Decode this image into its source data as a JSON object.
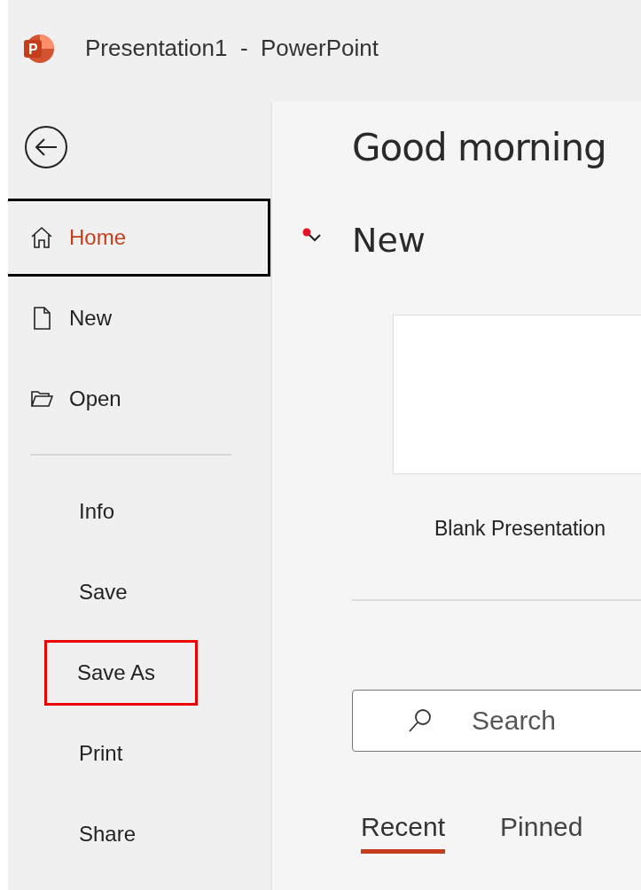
{
  "window": {
    "title": "Presentation1  -  PowerPoint"
  },
  "sidebar": {
    "items": [
      {
        "label": "Home",
        "kind": "home",
        "selected": true,
        "highlighted": false
      },
      {
        "label": "New",
        "kind": "document",
        "selected": false,
        "highlighted": false
      },
      {
        "label": "Open",
        "kind": "folder",
        "selected": false,
        "highlighted": false
      },
      {
        "kind": "divider"
      },
      {
        "label": "Info",
        "selected": false,
        "highlighted": false
      },
      {
        "label": "Save",
        "selected": false,
        "highlighted": false
      },
      {
        "label": "Save As",
        "selected": false,
        "highlighted": true
      },
      {
        "label": "Print",
        "selected": false,
        "highlighted": false
      },
      {
        "label": "Share",
        "selected": false,
        "highlighted": false
      }
    ]
  },
  "main": {
    "greeting": "Good morning",
    "new_section": {
      "title": "New",
      "expanded": true,
      "templates": [
        {
          "label": "Blank Presentation"
        }
      ]
    },
    "search": {
      "placeholder": "Search"
    },
    "tabs": [
      {
        "label": "Recent",
        "selected": true
      },
      {
        "label": "Pinned",
        "selected": false
      }
    ]
  }
}
